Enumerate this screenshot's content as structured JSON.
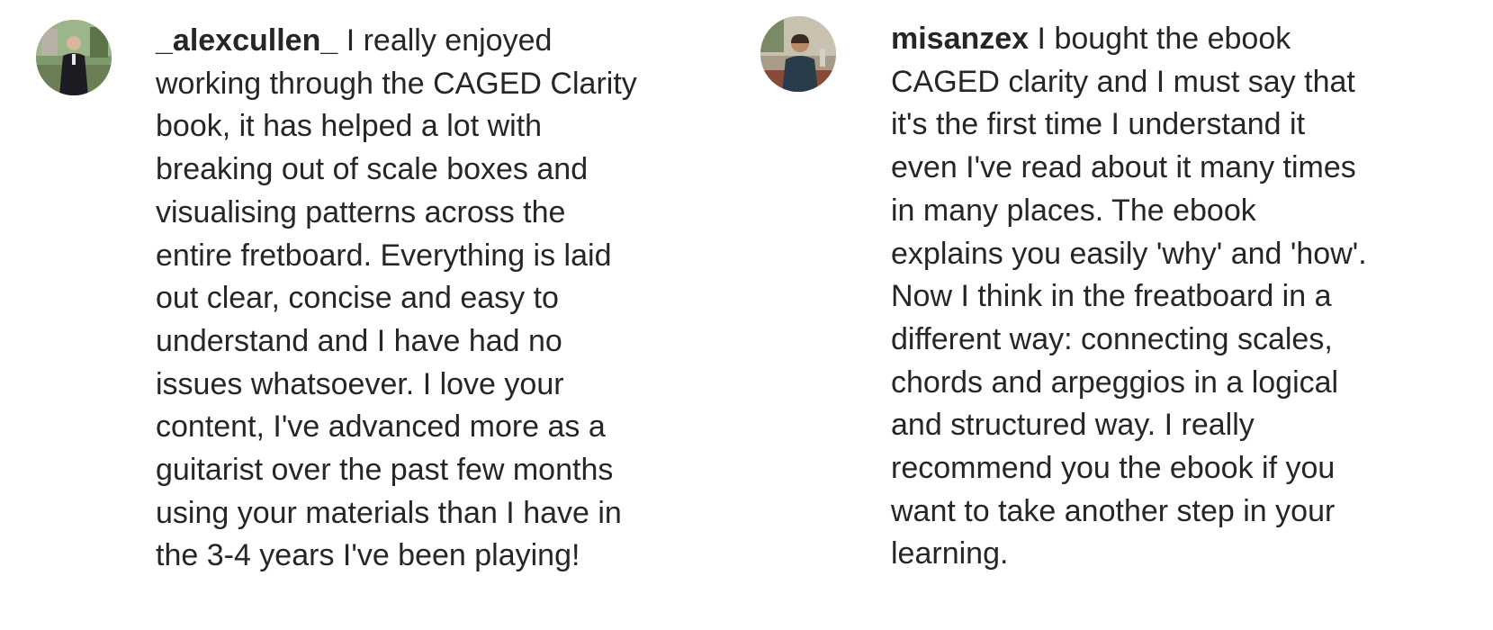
{
  "comments": [
    {
      "username": "_alexcullen_",
      "lines": [
        "I really enjoyed",
        "working through the CAGED Clarity",
        "book, it has helped a lot with",
        "breaking out of scale boxes and",
        "visualising patterns across the",
        "entire fretboard. Everything is laid",
        "out clear, concise and easy to",
        "understand and I have had no",
        "issues whatsoever. I love your",
        "content, I've advanced more as a",
        "guitarist over the past few months",
        "using your materials than I have in",
        "the 3-4 years I've been playing!"
      ]
    },
    {
      "username": "misanzex",
      "lines": [
        "I bought the ebook",
        "CAGED clarity and I must say that",
        "it's the first time I understand it",
        "even I've read about it many times",
        "in many places. The ebook",
        "explains you easily 'why' and 'how'.",
        "Now I think in the freatboard in a",
        "different way: connecting scales,",
        "chords and arpeggios in a logical",
        "and structured way. I really",
        "recommend you the ebook if you",
        "want to take another step in your",
        "learning."
      ]
    }
  ]
}
